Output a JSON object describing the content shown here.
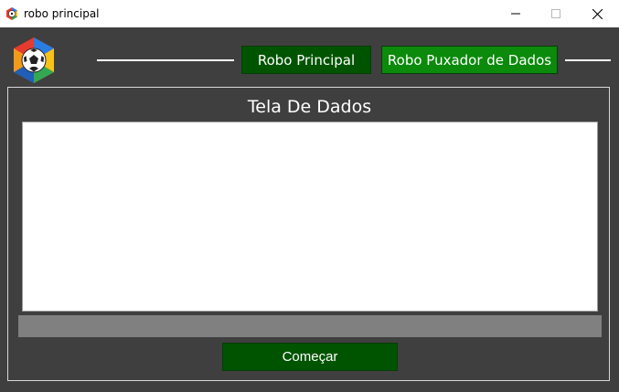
{
  "window": {
    "title": "robo principal"
  },
  "header": {
    "nav_buttons": [
      {
        "label": "Robo Principal",
        "color": "#005400"
      },
      {
        "label": "Robo Puxador de Dados",
        "color": "#0b8a0b"
      }
    ]
  },
  "main": {
    "title": "Tela De Dados",
    "data_text": "",
    "start_label": "Começar"
  },
  "colors": {
    "background": "#3f3f3f",
    "dark_green": "#005400",
    "bright_green": "#0b8a0b",
    "progress_track": "#808080"
  },
  "icons": [
    "app-logo-icon",
    "minimize-icon",
    "maximize-icon",
    "close-icon",
    "soccer-ball-logo"
  ]
}
